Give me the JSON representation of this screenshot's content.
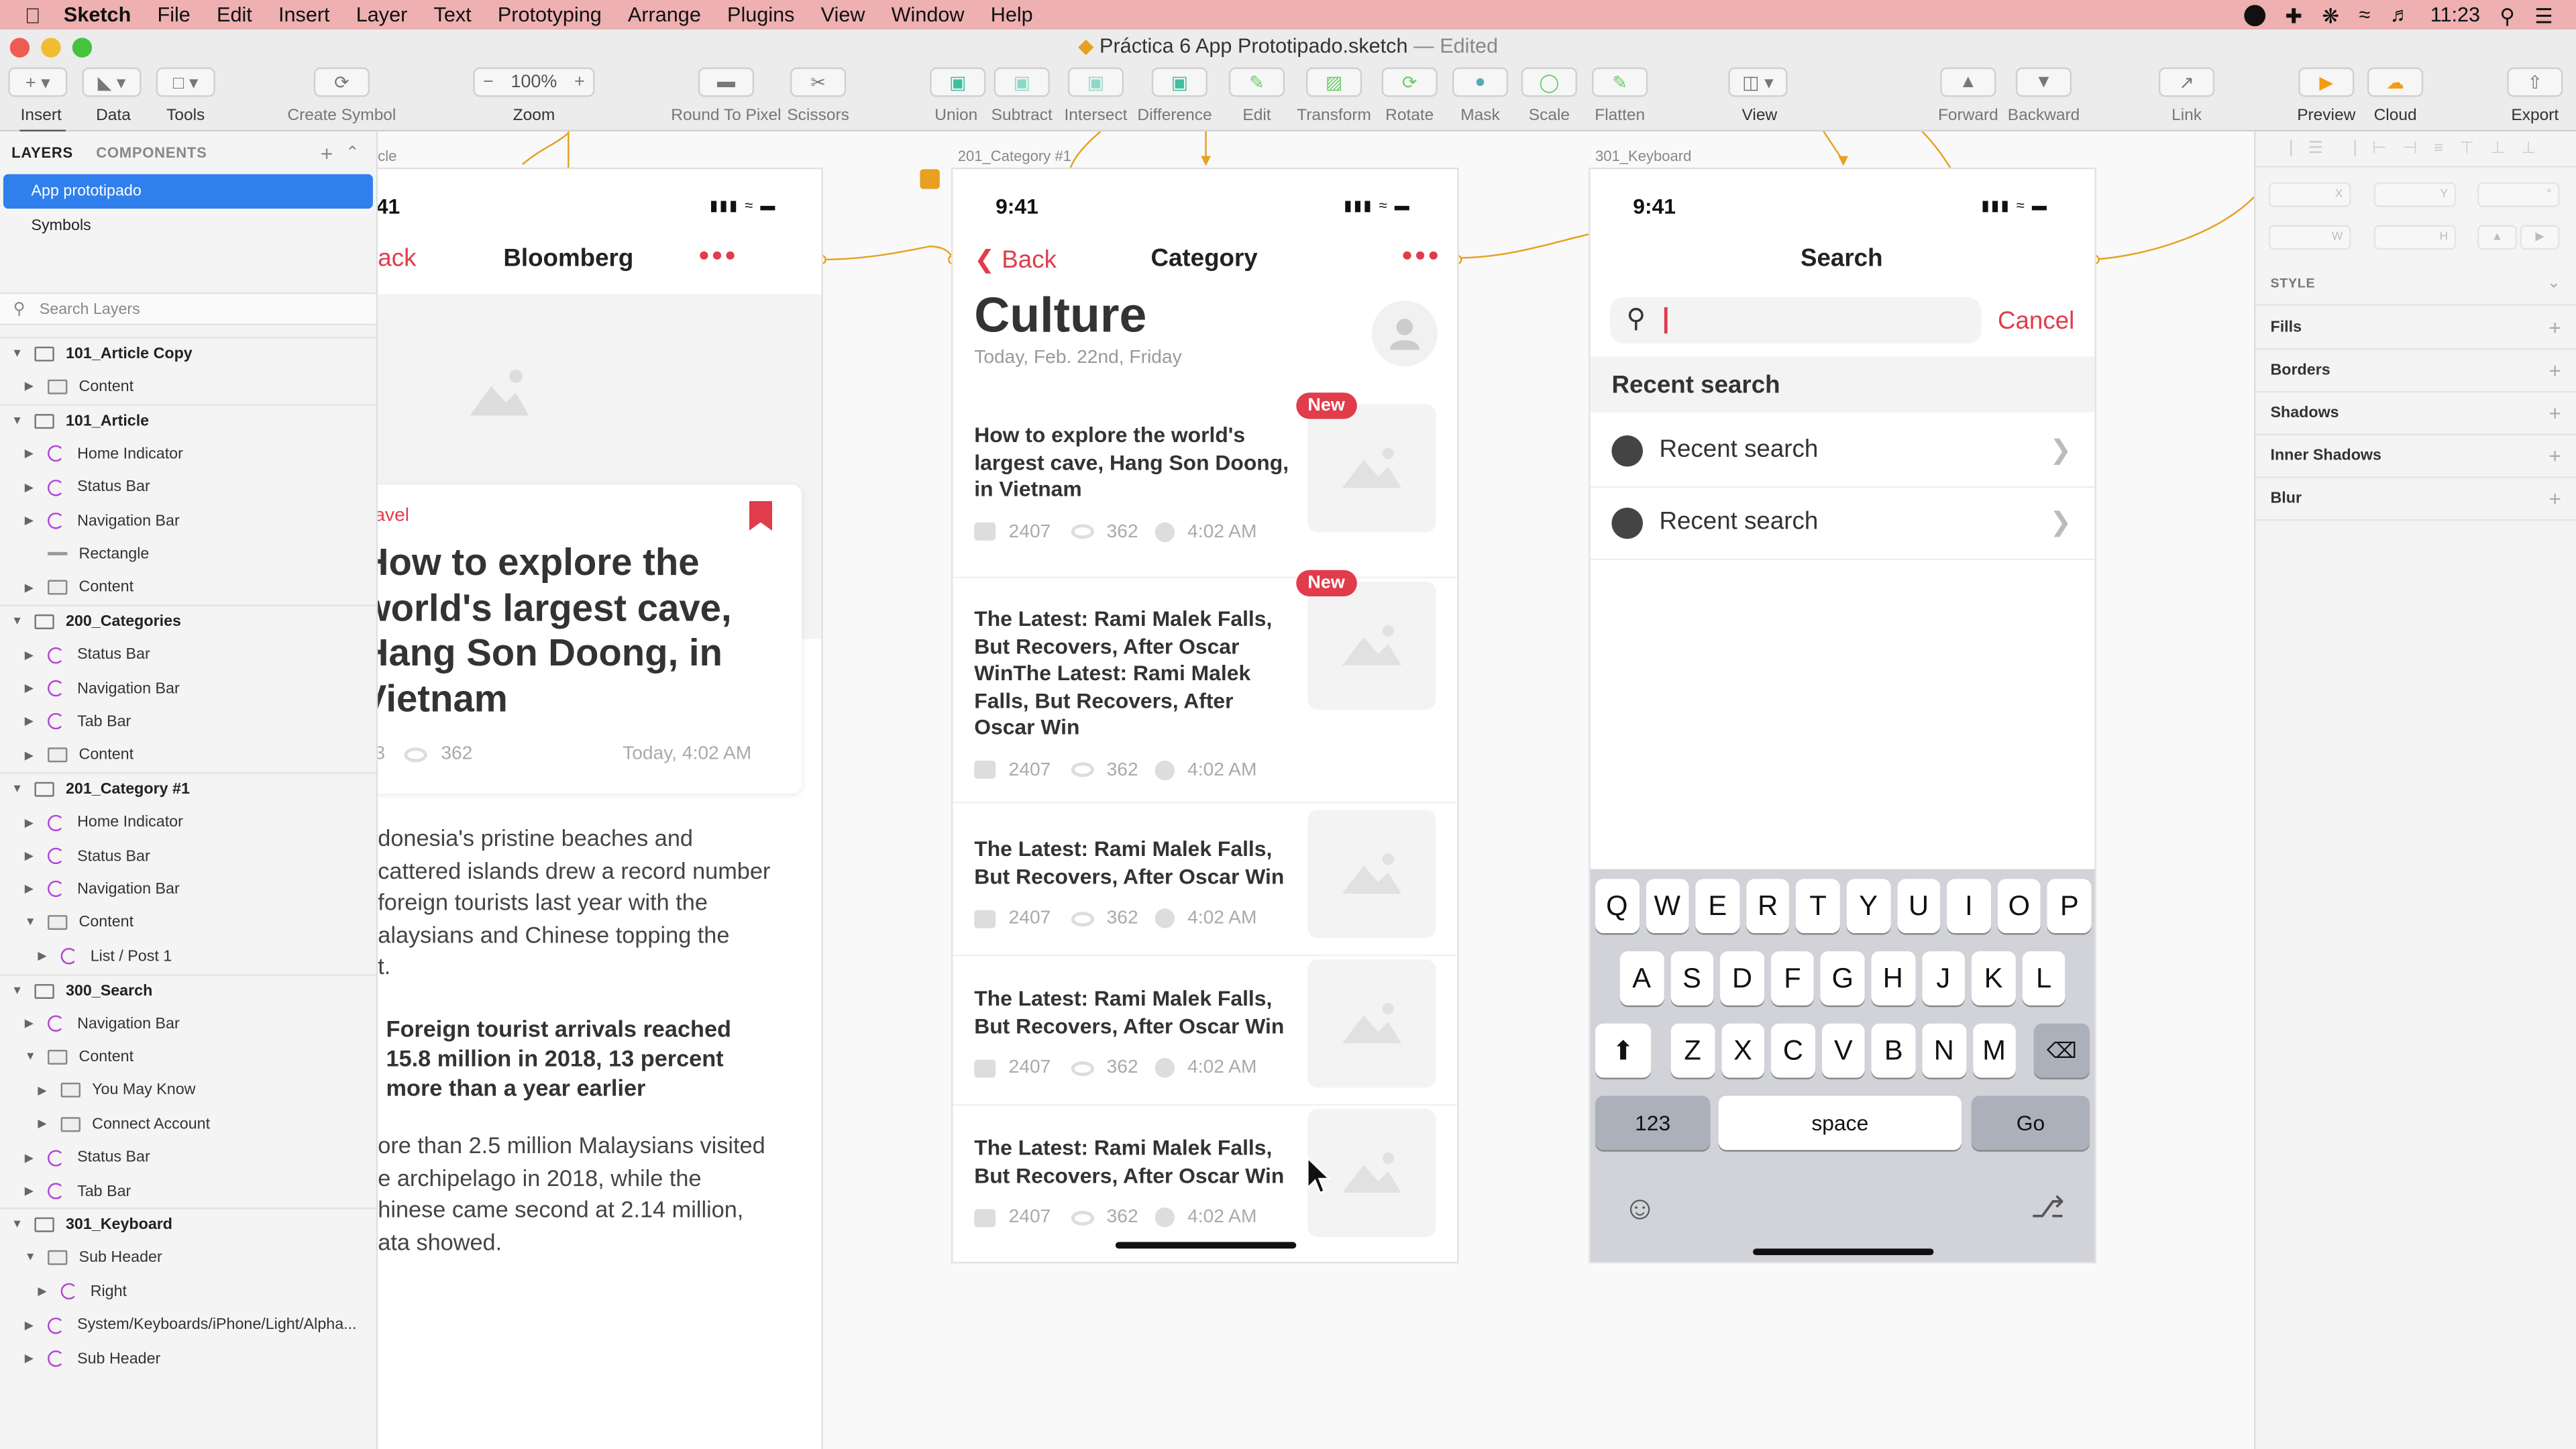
{
  "menubar": {
    "app_name": "Sketch",
    "items": [
      "File",
      "Edit",
      "Insert",
      "Layer",
      "Text",
      "Prototyping",
      "Arrange",
      "Plugins",
      "View",
      "Window",
      "Help"
    ],
    "clock": "11:23"
  },
  "window": {
    "title": "Práctica 6 App Prototipado.sketch",
    "edited": "— Edited"
  },
  "toolbar": {
    "insert": "Insert",
    "data": "Data",
    "tools": "Tools",
    "create_symbol": "Create Symbol",
    "zoom_value": "100%",
    "zoom": "Zoom",
    "round_to_pixel": "Round To Pixel",
    "scissors": "Scissors",
    "union": "Union",
    "subtract": "Subtract",
    "intersect": "Intersect",
    "difference": "Difference",
    "edit": "Edit",
    "transform": "Transform",
    "rotate": "Rotate",
    "mask": "Mask",
    "scale": "Scale",
    "flatten": "Flatten",
    "view": "View",
    "forward": "Forward",
    "backward": "Backward",
    "link": "Link",
    "preview": "Preview",
    "cloud": "Cloud",
    "export": "Export"
  },
  "sidebar": {
    "tab_layers": "LAYERS",
    "tab_components": "COMPONENTS",
    "pages": [
      "App prototipado",
      "Symbols"
    ],
    "search_placeholder": "Search Layers",
    "layers": [
      {
        "label": "101_Article Copy",
        "kind": "artboard"
      },
      {
        "label": "Content",
        "kind": "folder"
      },
      {
        "label": "101_Article",
        "kind": "artboard"
      },
      {
        "label": "Home Indicator",
        "kind": "symbol"
      },
      {
        "label": "Status Bar",
        "kind": "symbol"
      },
      {
        "label": "Navigation Bar",
        "kind": "symbol"
      },
      {
        "label": "Rectangle",
        "kind": "shape"
      },
      {
        "label": "Content",
        "kind": "folder"
      },
      {
        "label": "200_Categories",
        "kind": "artboard"
      },
      {
        "label": "Status Bar",
        "kind": "symbol"
      },
      {
        "label": "Navigation Bar",
        "kind": "symbol"
      },
      {
        "label": "Tab Bar",
        "kind": "symbol"
      },
      {
        "label": "Content",
        "kind": "folder"
      },
      {
        "label": "201_Category #1",
        "kind": "artboard"
      },
      {
        "label": "Home Indicator",
        "kind": "symbol"
      },
      {
        "label": "Status Bar",
        "kind": "symbol"
      },
      {
        "label": "Navigation Bar",
        "kind": "symbol"
      },
      {
        "label": "Content",
        "kind": "folder"
      },
      {
        "label": "List / Post 1",
        "kind": "symbol"
      },
      {
        "label": "300_Search",
        "kind": "artboard"
      },
      {
        "label": "Navigation Bar",
        "kind": "symbol"
      },
      {
        "label": "Content",
        "kind": "folder"
      },
      {
        "label": "You May Know",
        "kind": "folder"
      },
      {
        "label": "Connect Account",
        "kind": "folder"
      },
      {
        "label": "Status Bar",
        "kind": "symbol"
      },
      {
        "label": "Tab Bar",
        "kind": "symbol"
      },
      {
        "label": "301_Keyboard",
        "kind": "artboard"
      },
      {
        "label": "Sub Header",
        "kind": "folder"
      },
      {
        "label": "Right",
        "kind": "symbol"
      },
      {
        "label": "System/Keyboards/iPhone/Light/Alpha...",
        "kind": "symbol"
      },
      {
        "label": "Sub Header",
        "kind": "symbol"
      }
    ]
  },
  "article": {
    "artboard_label": "cle",
    "time": "41",
    "back": "ack",
    "title": "Bloomberg",
    "tag": "avel",
    "headline": [
      "How to explore the",
      "world's largest cave,",
      "Hang Son Doong, in",
      "Vietnam"
    ],
    "comments": "3",
    "views": "362",
    "date": "Today, 4:02 AM",
    "body1": [
      "donesia's pristine beaches and",
      "cattered islands drew a record number",
      " foreign tourists last year with the",
      "alaysians and Chinese topping the",
      "t."
    ],
    "quote": [
      "Foreign tourist arrivals reached",
      "15.8 million in 2018, 13 percent",
      "more than a year earlier"
    ],
    "body2": [
      "ore than 2.5 million Malaysians visited",
      "e archipelago in 2018, while the",
      "hinese came second at 2.14 million,",
      "ata showed."
    ]
  },
  "category": {
    "artboard_label": "201_Category #1",
    "time": "9:41",
    "back": "Back",
    "nav_title": "Category",
    "title": "Culture",
    "date": "Today, Feb. 22nd, Friday",
    "badge_new": "New",
    "posts": [
      {
        "title": [
          "How to explore the world's",
          "largest cave, Hang Son Doong,",
          "in Vietnam"
        ],
        "comments": "2407",
        "views": "362",
        "time": "4:02 AM",
        "is_new": true
      },
      {
        "title": [
          "The Latest: Rami Malek Falls,",
          "But Recovers, After Oscar",
          "WinThe Latest: Rami Malek",
          "Falls, But Recovers, After",
          "Oscar Win"
        ],
        "comments": "2407",
        "views": "362",
        "time": "4:02 AM",
        "is_new": true
      },
      {
        "title": [
          "The Latest: Rami Malek Falls,",
          "But Recovers, After Oscar Win"
        ],
        "comments": "2407",
        "views": "362",
        "time": "4:02 AM",
        "is_new": false
      },
      {
        "title": [
          "The Latest: Rami Malek Falls,",
          "But Recovers, After Oscar Win"
        ],
        "comments": "2407",
        "views": "362",
        "time": "4:02 AM",
        "is_new": false
      },
      {
        "title": [
          "The Latest: Rami Malek Falls,",
          "But Recovers, After Oscar Win"
        ],
        "comments": "2407",
        "views": "362",
        "time": "4:02 AM",
        "is_new": false
      }
    ]
  },
  "search": {
    "artboard_label": "301_Keyboard",
    "time": "9:41",
    "title": "Search",
    "cancel": "Cancel",
    "recent_header": "Recent search",
    "recent_items": [
      "Recent search",
      "Recent search"
    ],
    "keys_row1": [
      "Q",
      "W",
      "E",
      "R",
      "T",
      "Y",
      "U",
      "I",
      "O",
      "P"
    ],
    "keys_row2": [
      "A",
      "S",
      "D",
      "F",
      "G",
      "H",
      "J",
      "K",
      "L"
    ],
    "keys_row3": [
      "Z",
      "X",
      "C",
      "V",
      "B",
      "N",
      "M"
    ],
    "key_123": "123",
    "key_space": "space",
    "key_go": "Go"
  },
  "inspector": {
    "field_x": "X",
    "field_y": "Y",
    "field_w": "W",
    "field_h": "H",
    "style": "STYLE",
    "sections": [
      "Fills",
      "Borders",
      "Shadows",
      "Inner Shadows",
      "Blur"
    ]
  },
  "colors": {
    "accent": "#e03c4c",
    "selection": "#2f80ed",
    "menubar": "#eeb0b0",
    "link_orange": "#e8a020"
  }
}
